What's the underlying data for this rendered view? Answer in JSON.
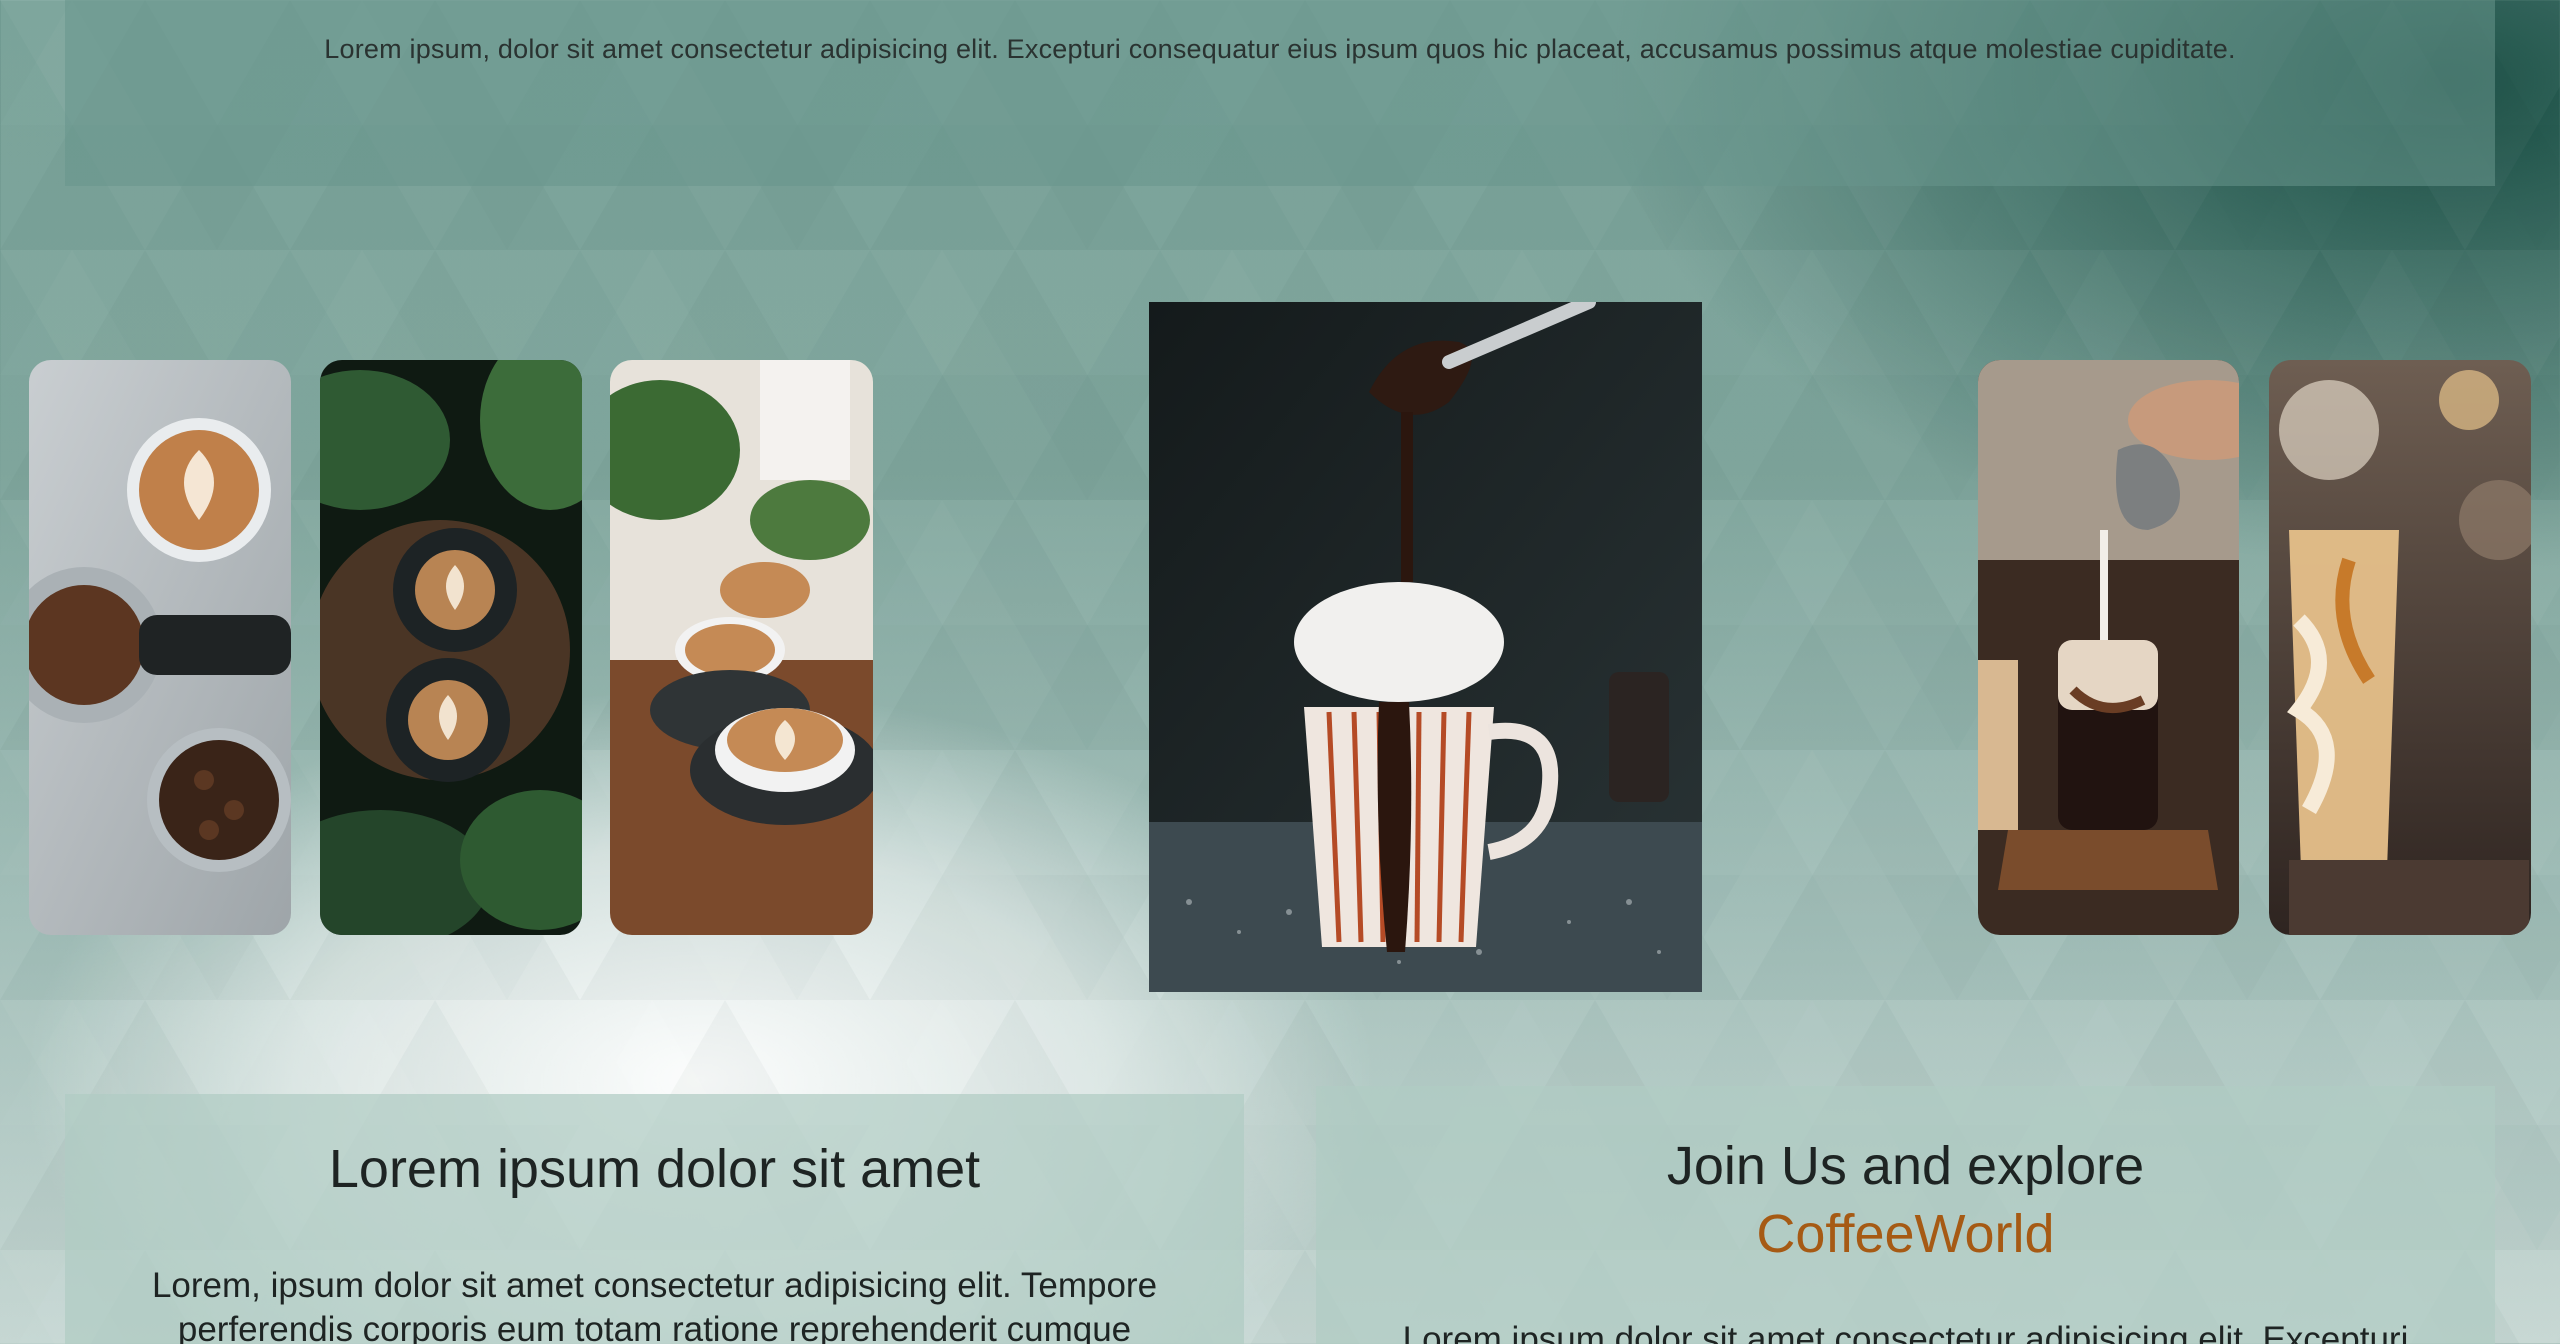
{
  "top_banner": {
    "text": "Lorem ipsum, dolor sit amet consectetur adipisicing elit. Excepturi consequatur eius ipsum quos hic placeat, accusamus possimus atque molestiae cupiditate."
  },
  "gallery": {
    "images": [
      {
        "subject": "latte-cups-and-beans-image"
      },
      {
        "subject": "two-lattes-on-wood-tray-image"
      },
      {
        "subject": "cappuccino-cups-with-plants-image"
      },
      {
        "subject": "hot-chocolate-mug-image"
      },
      {
        "subject": "milk-pour-iced-coffee-image"
      },
      {
        "subject": "iced-latte-glass-image"
      }
    ]
  },
  "left_panel": {
    "title": "Lorem ipsum dolor sit amet",
    "text": "Lorem, ipsum dolor sit amet consectetur adipisicing elit. Tempore perferendis corporis eum totam ratione reprehenderit cumque"
  },
  "right_panel": {
    "title_line1": "Join Us and explore",
    "title_brand": "CoffeeWorld",
    "text": "Lorem ipsum dolor sit amet consectetur adipisicing elit. Excepturi"
  },
  "colors": {
    "brand": "#a65a14",
    "panel": "#b0ccc4",
    "background_teal": "#7aa39a",
    "dark_teal": "#12483e"
  }
}
